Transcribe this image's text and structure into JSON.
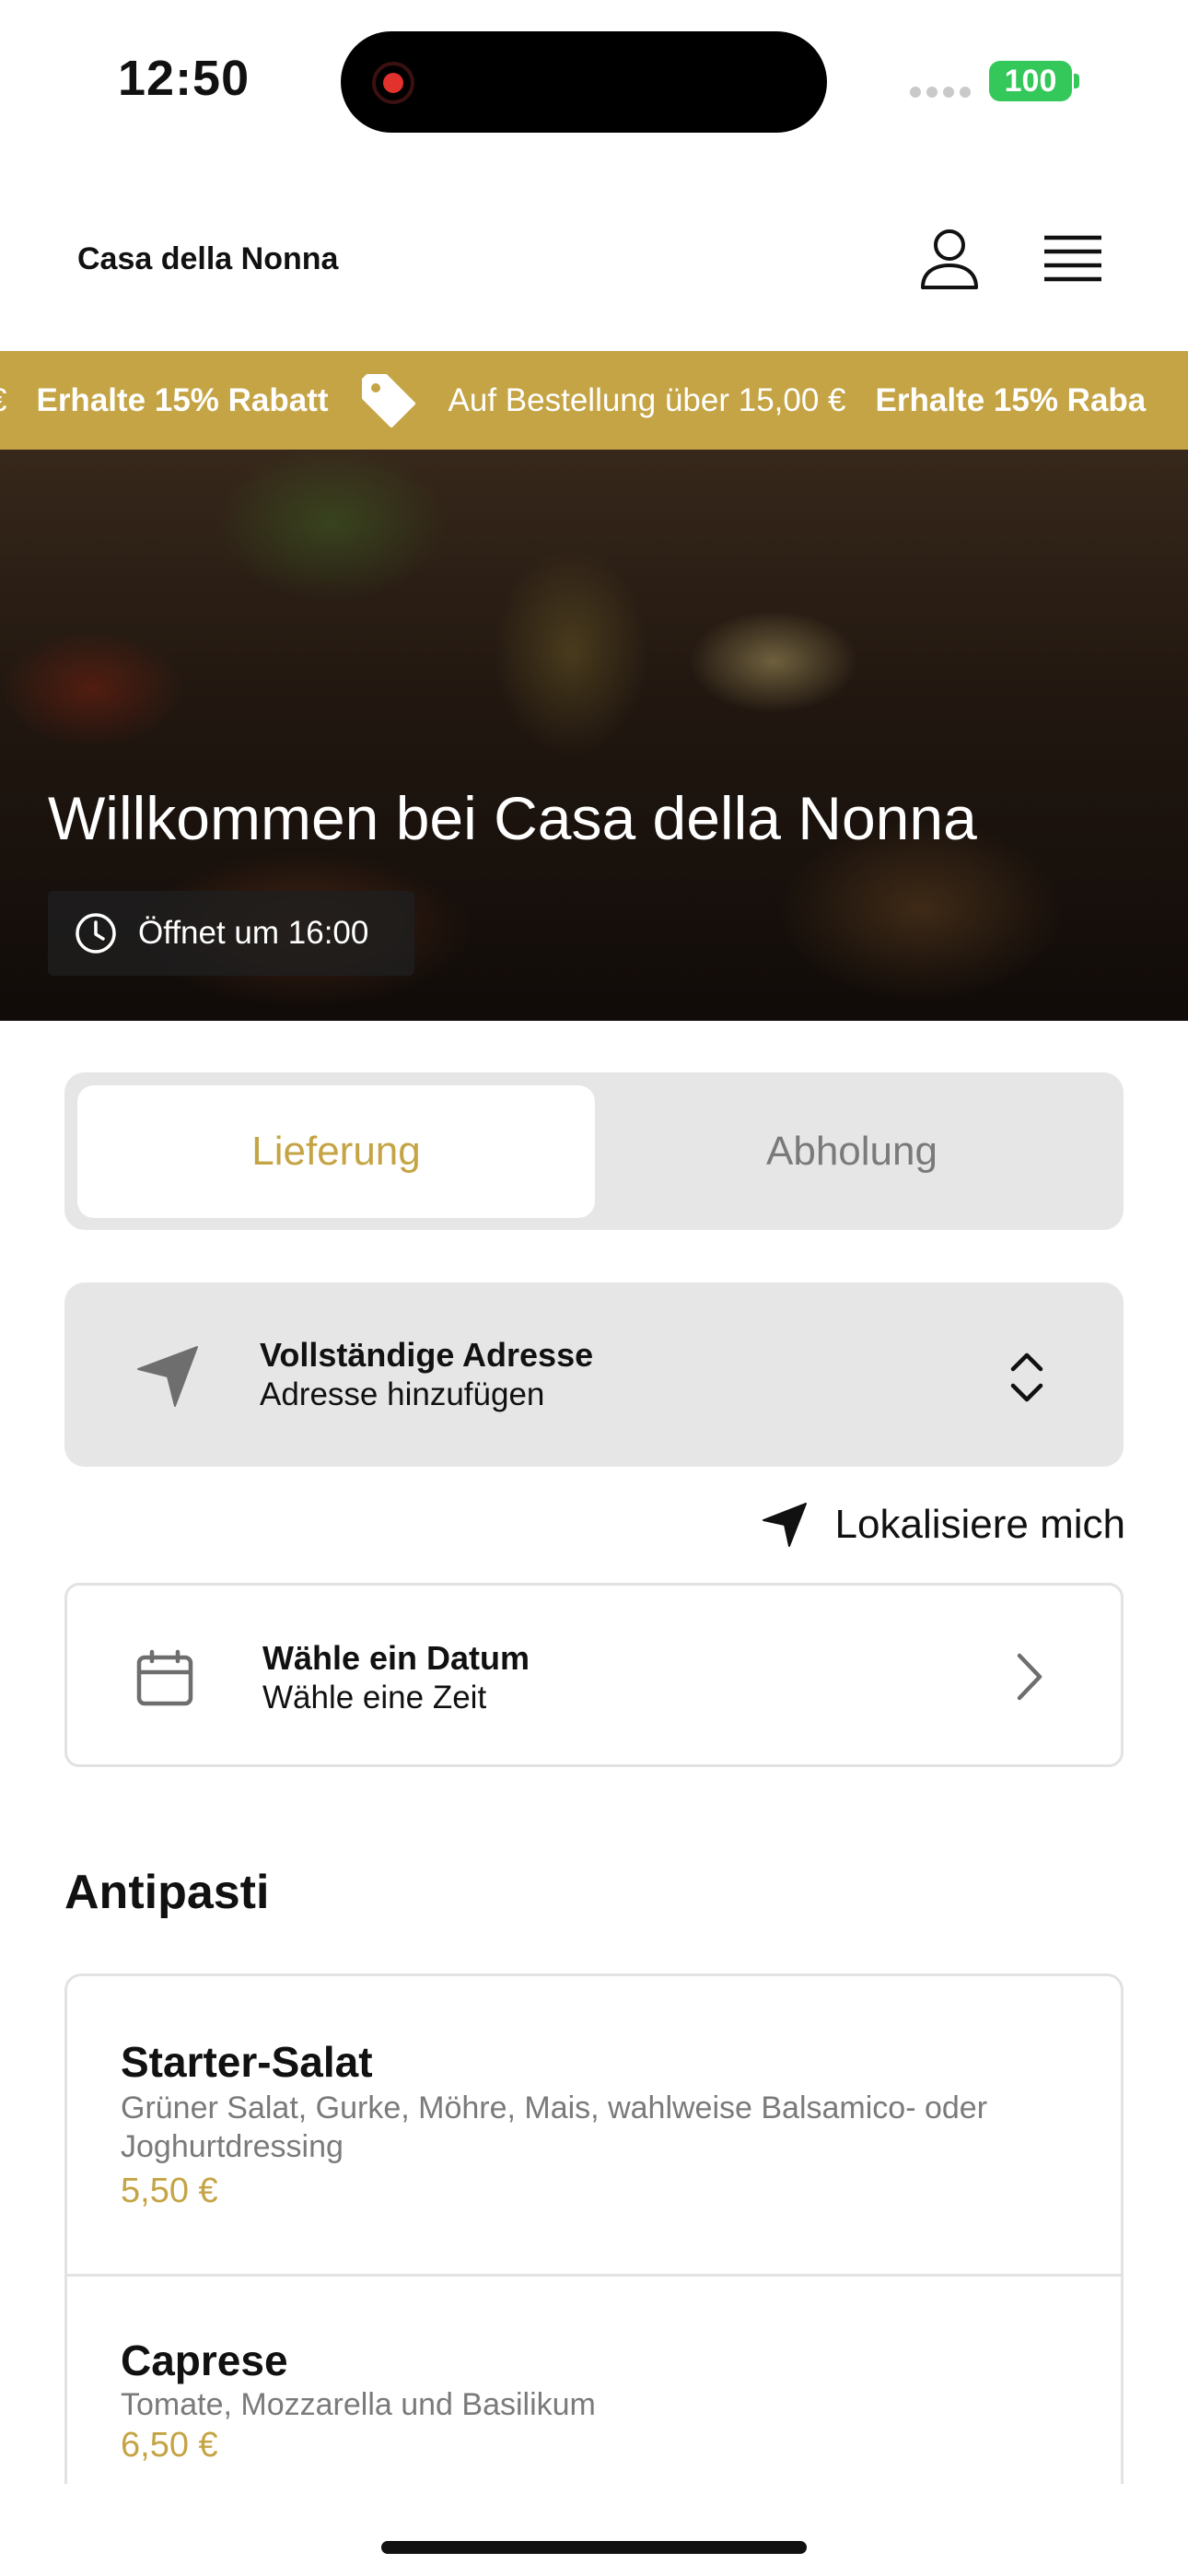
{
  "status_bar": {
    "time": "12:50",
    "battery": "100"
  },
  "header": {
    "brand": "Casa della Nonna"
  },
  "promo": {
    "items": [
      "€",
      "Erhalte 15% Rabatt",
      "Auf Bestellung über 15,00 €",
      "Erhalte 15% Raba"
    ],
    "color": "#c5a445"
  },
  "hero": {
    "title": "Willkommen bei Casa della Nonna",
    "opening": "Öffnet um 16:00"
  },
  "order_mode": {
    "options": [
      "Lieferung",
      "Abholung"
    ],
    "selected": "Lieferung"
  },
  "address": {
    "title": "Vollständige Adresse",
    "placeholder": "Adresse hinzufügen"
  },
  "locate": {
    "label": "Lokalisiere mich"
  },
  "schedule": {
    "date_label": "Wähle ein Datum",
    "time_label": "Wähle eine Zeit"
  },
  "menu": {
    "section": "Antipasti",
    "items": [
      {
        "name": "Starter-Salat",
        "description": "Grüner Salat, Gurke, Möhre, Mais, wahlweise Balsamico- oder Joghurtdressing",
        "price": "5,50 €"
      },
      {
        "name": "Caprese",
        "description": "Tomate, Mozzarella und Basilikum",
        "price": "6,50 €"
      }
    ]
  },
  "colors": {
    "accent": "#c5a445",
    "panel": "#e6e6e6",
    "text": "#111111",
    "muted": "#7a7a7a"
  }
}
